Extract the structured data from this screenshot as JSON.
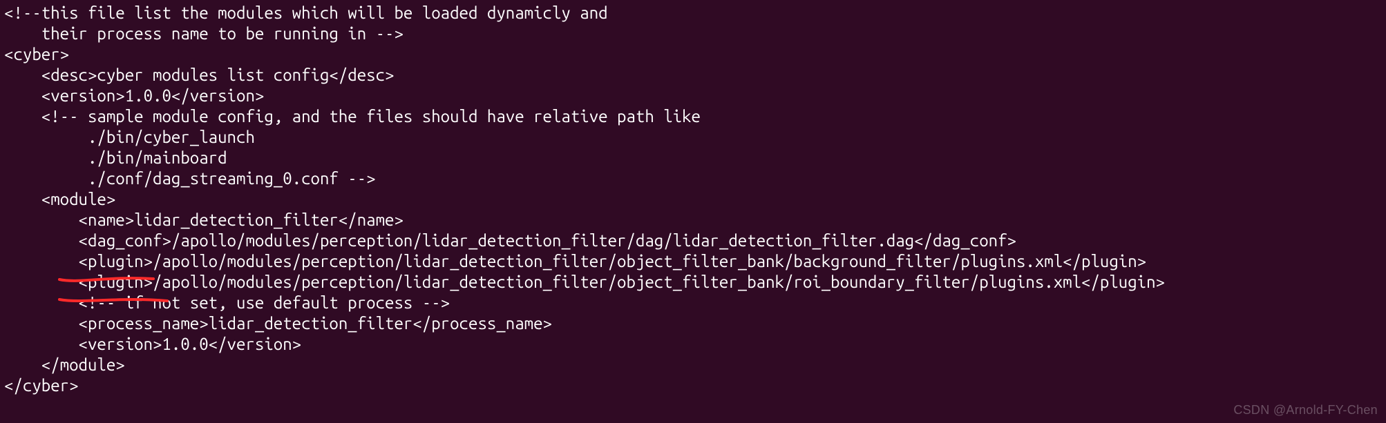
{
  "lines": {
    "l0": "<!--this file list the modules which will be loaded dynamicly and",
    "l1": "    their process name to be running in -->",
    "l2": "<cyber>",
    "l3": "    <desc>cyber modules list config</desc>",
    "l4": "    <version>1.0.0</version>",
    "l5": "    <!-- sample module config, and the files should have relative path like",
    "l6": "         ./bin/cyber_launch",
    "l7": "         ./bin/mainboard",
    "l8": "         ./conf/dag_streaming_0.conf -->",
    "l9": "    <module>",
    "l10": "        <name>lidar_detection_filter</name>",
    "l11": "        <dag_conf>/apollo/modules/perception/lidar_detection_filter/dag/lidar_detection_filter.dag</dag_conf>",
    "l12": "        <plugin>/apollo/modules/perception/lidar_detection_filter/object_filter_bank/background_filter/plugins.xml</plugin>",
    "l13": "        <plugin>/apollo/modules/perception/lidar_detection_filter/object_filter_bank/roi_boundary_filter/plugins.xml</plugin>",
    "l14": "        <!-- if not set, use default process -->",
    "l15": "        <process_name>lidar_detection_filter</process_name>",
    "l16": "        <version>1.0.0</version>",
    "l17": "    </module>",
    "l18": "</cyber>"
  },
  "watermark": "CSDN @Arnold-FY-Chen"
}
